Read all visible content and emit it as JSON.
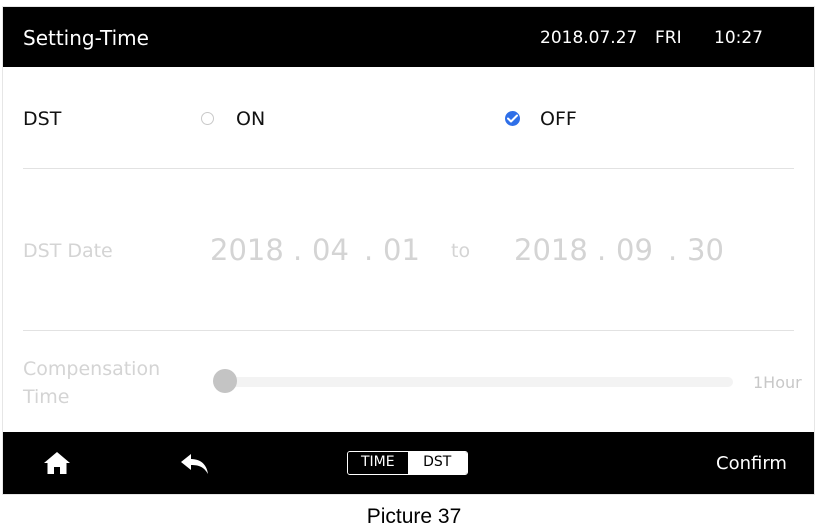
{
  "header": {
    "title": "Setting-Time",
    "date": "2018.07.27",
    "weekday": "FRI",
    "time": "10:27"
  },
  "dst": {
    "label": "DST",
    "on_label": "ON",
    "off_label": "OFF",
    "selected": "OFF",
    "accent_color": "#2f6fe8"
  },
  "dst_date": {
    "label": "DST Date",
    "start_year": "2018",
    "start_month": "04",
    "start_day": "01",
    "separator": ".",
    "to_label": "to",
    "end_year": "2018",
    "end_month": "09",
    "end_day": "30"
  },
  "compensation": {
    "label": "Compensation Time",
    "max_label": "1Hour",
    "value_fraction": 0
  },
  "footer": {
    "home_icon": "home-icon",
    "back_icon": "back-arrow-icon",
    "tab_time": "TIME",
    "tab_dst": "DST",
    "active_tab": "DST",
    "confirm_label": "Confirm"
  },
  "caption": "Picture 37"
}
